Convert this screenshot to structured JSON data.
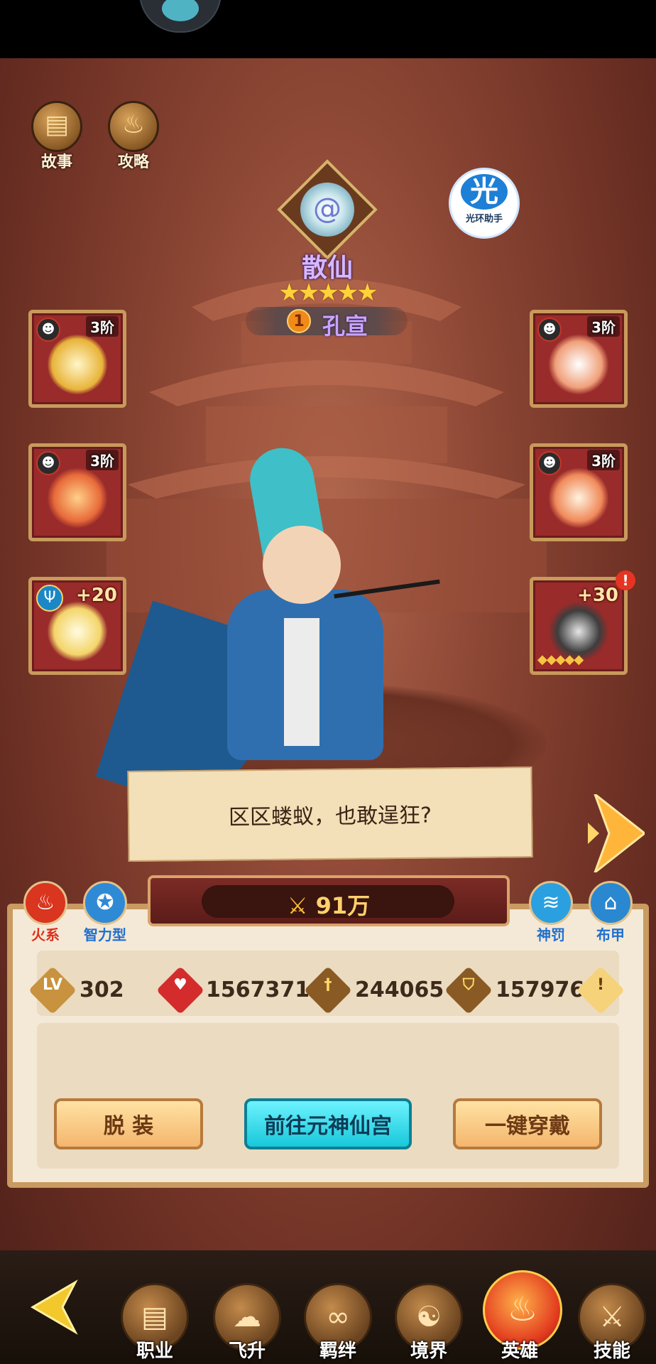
{
  "top_buttons": [
    {
      "label": "故事",
      "icon": "book-icon"
    },
    {
      "label": "攻略",
      "icon": "flame-icon"
    }
  ],
  "assistant": {
    "glyph": "光",
    "label": "光环助手"
  },
  "hero": {
    "class_name": "散仙",
    "stars": "★★★★★",
    "rank": "1",
    "name": "孔宣",
    "quote": "区区蝼蚁，也敢逞狂?"
  },
  "equipment": {
    "left": [
      {
        "tier": "3阶",
        "icon": "axe-weapon-icon"
      },
      {
        "tier": "3阶",
        "icon": "armor-chest-icon"
      },
      {
        "plus": "+20",
        "icon": "mirror-treasure-icon"
      }
    ],
    "right": [
      {
        "tier": "3阶",
        "icon": "shoulder-armor-icon"
      },
      {
        "tier": "3阶",
        "icon": "boots-icon"
      },
      {
        "plus": "+30",
        "icon": "divine-weapon-icon",
        "alert": "!"
      }
    ]
  },
  "power": {
    "value": "91万"
  },
  "tags_left": [
    {
      "icon": "fire-element-icon",
      "label": "火系",
      "color": "#e0301e"
    },
    {
      "icon": "intelligence-icon",
      "label": "智力型",
      "color": "#1f6fd0"
    }
  ],
  "tags_right": [
    {
      "icon": "divine-punishment-icon",
      "label": "神罚",
      "color": "#1f6fd0"
    },
    {
      "icon": "cloth-armor-icon",
      "label": "布甲",
      "color": "#1f6fd0"
    }
  ],
  "stats": {
    "level_badge": "LV",
    "level": "302",
    "hp": "1567371",
    "attack": "244065",
    "defense": "157976",
    "info": "!"
  },
  "buttons": {
    "unequip": "脱 装",
    "goto": "前往元神仙宫",
    "equip_all": "一键穿戴"
  },
  "bottom_nav": [
    {
      "label": "职业",
      "icon": "book-icon"
    },
    {
      "label": "飞升",
      "icon": "cloud-icon"
    },
    {
      "label": "羁绊",
      "icon": "bond-icon"
    },
    {
      "label": "境界",
      "icon": "realm-icon"
    },
    {
      "label": "英雄",
      "icon": "hero-flame-icon",
      "active": true
    },
    {
      "label": "技能",
      "icon": "sword-icon"
    }
  ]
}
